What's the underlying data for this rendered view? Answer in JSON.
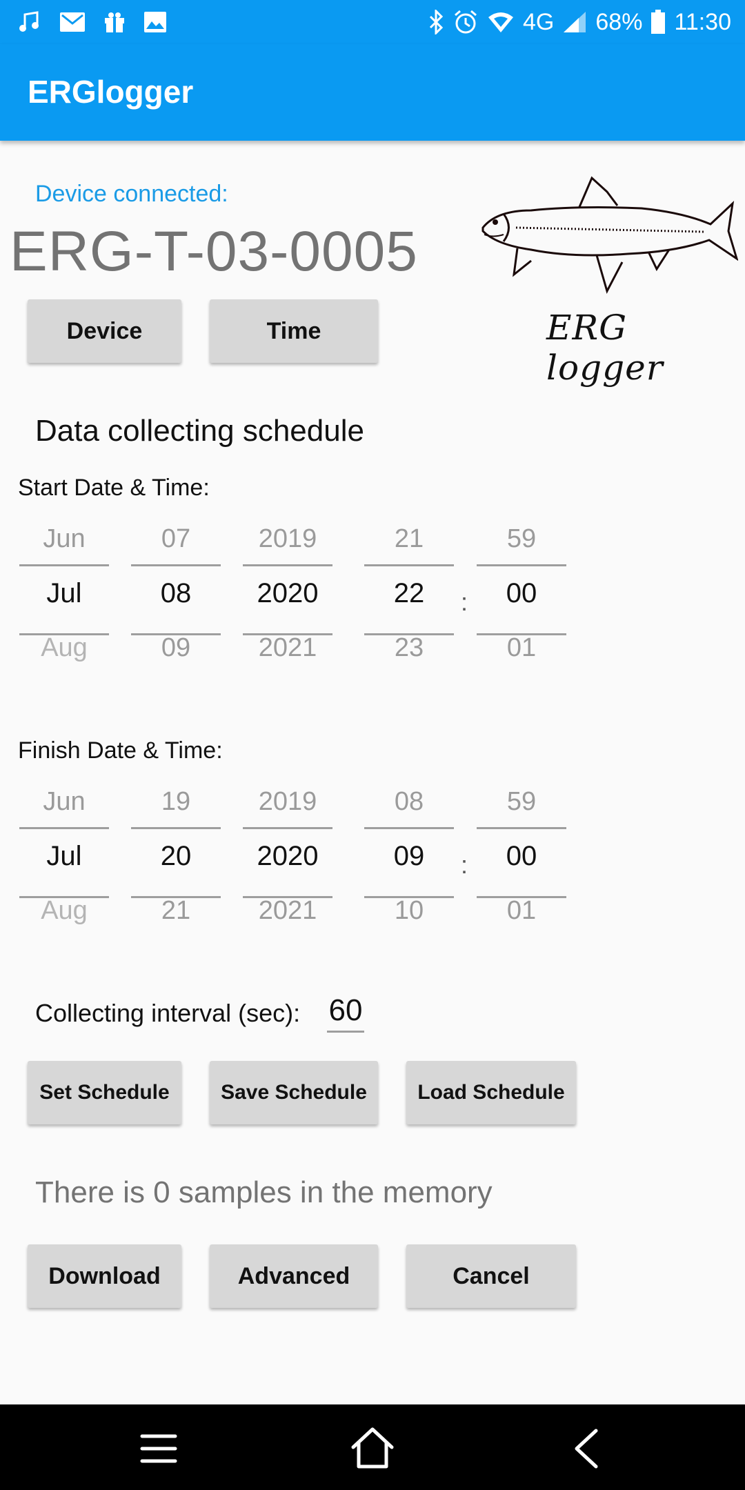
{
  "status_bar": {
    "icons_left": [
      "music-icon",
      "mail-icon",
      "gift-icon",
      "image-icon"
    ],
    "icons_right": [
      "bluetooth-icon",
      "alarm-icon",
      "wifi-icon",
      "signal-icon",
      "battery-icon"
    ],
    "network": "4G",
    "battery": "68%",
    "time": "11:30"
  },
  "app_bar": {
    "title": "ERGlogger"
  },
  "device": {
    "connected_label": "Device connected:",
    "id": "ERG-T-03-0005",
    "device_button": "Device",
    "time_button": "Time"
  },
  "logo": {
    "text": "ERG logger",
    "icon": "fish-logo"
  },
  "schedule": {
    "title": "Data collecting schedule",
    "start": {
      "label": "Start Date & Time:",
      "month": {
        "prev": "Jun",
        "cur": "Jul",
        "next": "Aug"
      },
      "day": {
        "prev": "07",
        "cur": "08",
        "next": "09"
      },
      "year": {
        "prev": "2019",
        "cur": "2020",
        "next": "2021"
      },
      "hour": {
        "prev": "21",
        "cur": "22",
        "next": "23"
      },
      "minute": {
        "prev": "59",
        "cur": "00",
        "next": "01"
      },
      "separator": ":"
    },
    "finish": {
      "label": "Finish Date & Time:",
      "month": {
        "prev": "Jun",
        "cur": "Jul",
        "next": "Aug"
      },
      "day": {
        "prev": "19",
        "cur": "20",
        "next": "21"
      },
      "year": {
        "prev": "2019",
        "cur": "2020",
        "next": "2021"
      },
      "hour": {
        "prev": "08",
        "cur": "09",
        "next": "10"
      },
      "minute": {
        "prev": "59",
        "cur": "00",
        "next": "01"
      },
      "separator": ":"
    },
    "interval_label": "Collecting interval (sec):",
    "interval_value": "60",
    "buttons": {
      "set": "Set Schedule",
      "save": "Save Schedule",
      "load": "Load Schedule"
    }
  },
  "memory": {
    "text": "There is 0 samples in the memory"
  },
  "actions": {
    "download": "Download",
    "advanced": "Advanced",
    "cancel": "Cancel"
  },
  "nav": {
    "icons": [
      "menu-icon",
      "home-icon",
      "back-icon"
    ]
  },
  "colors": {
    "primary": "#0a9af2",
    "accent_text": "#1a9be6",
    "button_bg": "#d7d7d7",
    "background": "#fafafa"
  }
}
